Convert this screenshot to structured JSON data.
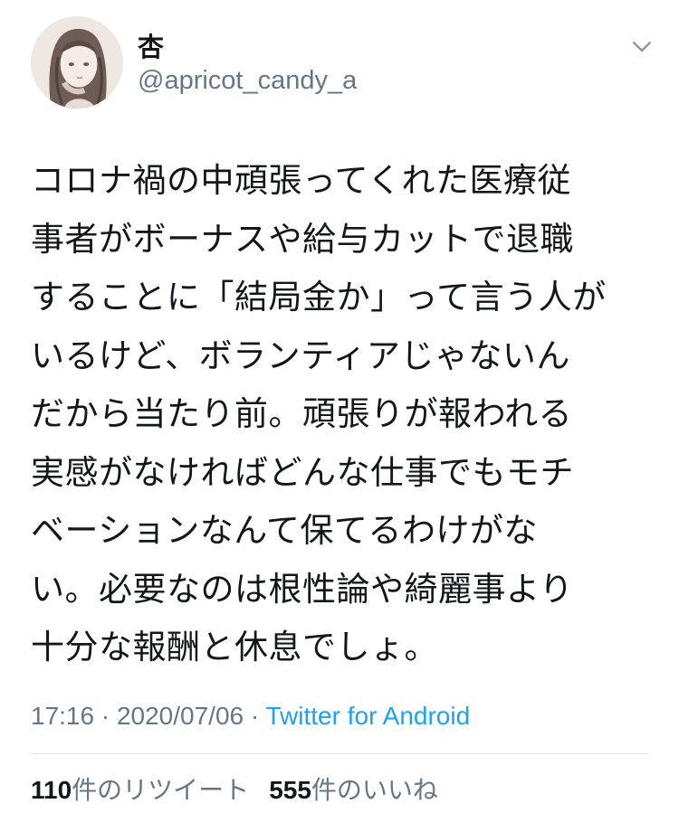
{
  "author": {
    "display_name": "杏",
    "handle": "@apricot_candy_a"
  },
  "tweet": {
    "text": "コロナ禍の中頑張ってくれた医療従\n事者がボーナスや給与カットで退職\nすることに「結局金か」って言う人が\nいるけど、ボランティアじゃないん\nだから当たり前。頑張りが報われる\n実感がなければどんな仕事でもモチ\nベーションなんて保てるわけがな\nい。必要なのは根性論や綺麗事より\n十分な報酬と休息でしょ。",
    "time": "17:16",
    "separator1": " · ",
    "date": "2020/07/06",
    "separator2": " · ",
    "source": "Twitter for Android"
  },
  "stats": {
    "retweet_count": "110",
    "retweet_label": "件のリツイート",
    "like_count": "555",
    "like_label": "件のいいね"
  },
  "icons": {
    "avatar": "user-avatar",
    "caret": "chevron-down-icon"
  },
  "colors": {
    "link": "#1da1f2",
    "secondary_text": "#657786",
    "divider": "#e1e8ed"
  }
}
